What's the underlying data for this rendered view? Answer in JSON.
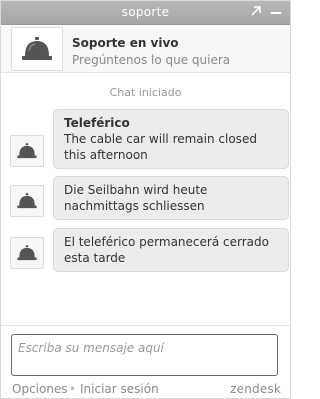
{
  "window": {
    "title": "soporte",
    "popout_icon": "popout-arrow-icon",
    "minimize_icon": "minimize-icon"
  },
  "header": {
    "avatar_icon": "service-bell-icon",
    "name": "Soporte en vivo",
    "tagline": "Pregúntenos lo que quiera"
  },
  "chat": {
    "started_label": "Chat iniciado",
    "messages": [
      {
        "sender": "Teleférico",
        "text": "The cable car will remain closed this afternoon",
        "avatar_icon": "service-bell-icon"
      },
      {
        "sender": "",
        "text": "Die Seilbahn wird heute nachmittags schliessen",
        "avatar_icon": "service-bell-icon"
      },
      {
        "sender": "",
        "text": "El teleférico permanecerá cerrado esta tarde",
        "avatar_icon": "service-bell-icon"
      }
    ]
  },
  "input": {
    "placeholder": "Escriba su mensaje aquí",
    "value": ""
  },
  "footer": {
    "options_label": "Opciones",
    "separator": "•",
    "login_label": "Iniciar sesión",
    "brand": "zendesk"
  },
  "colors": {
    "titlebar": "#a6a6a6",
    "bubble_bg": "#ececec",
    "text": "#333333",
    "muted": "#888888"
  }
}
